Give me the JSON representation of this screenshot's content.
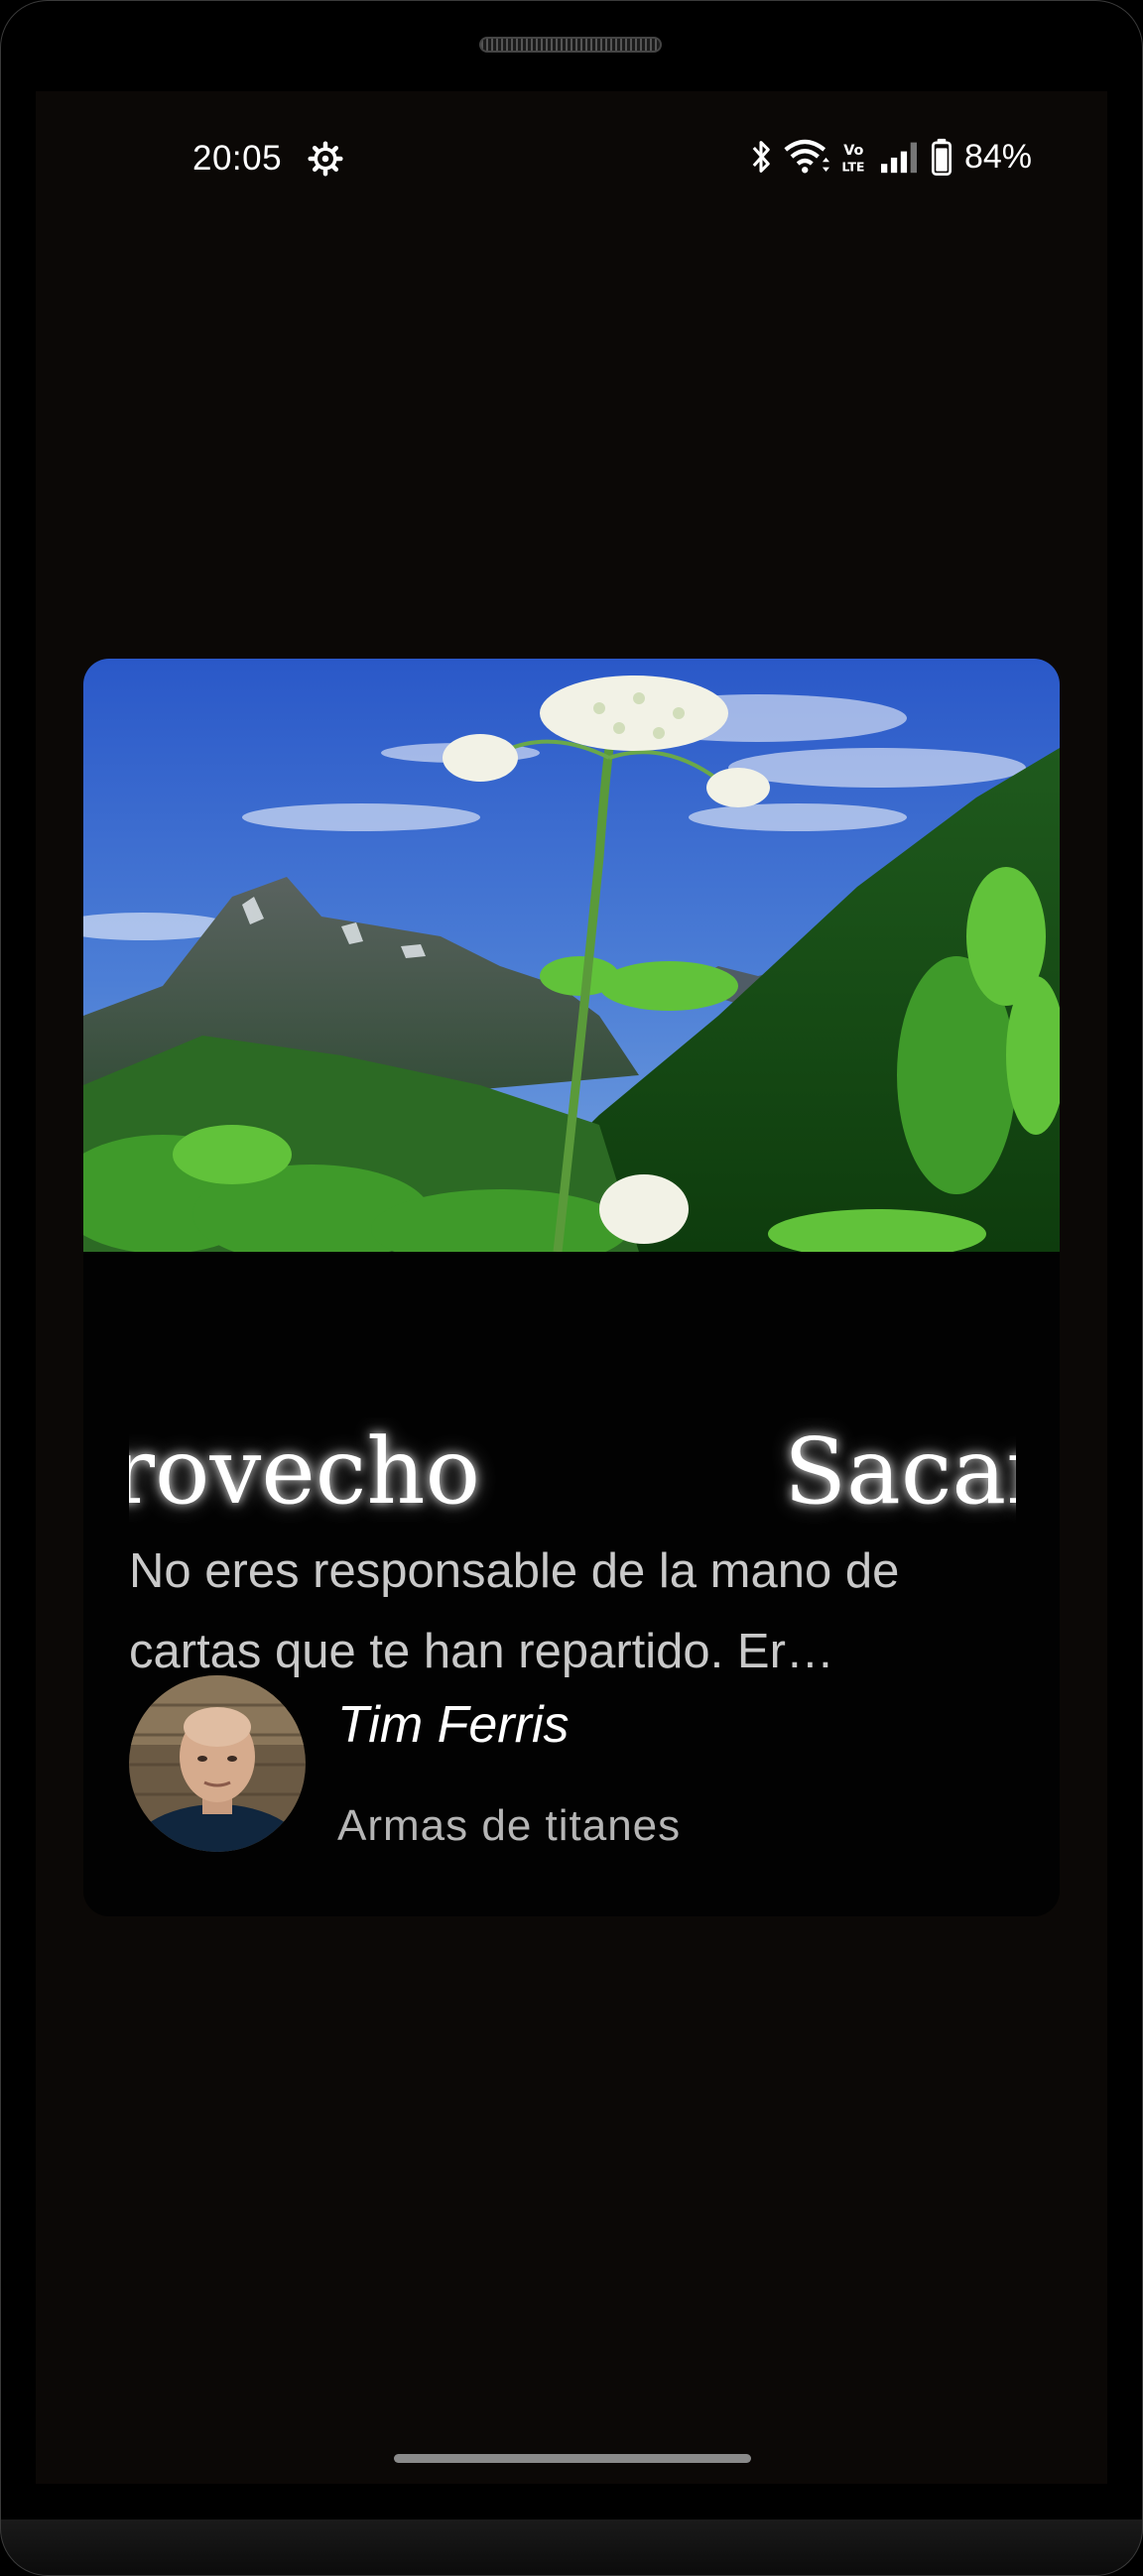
{
  "status_bar": {
    "time": "20:05",
    "battery_percent": "84%",
    "icons": [
      "settings-gear-icon",
      "bluetooth-icon",
      "wifi-icon",
      "volte-icon",
      "signal-icon",
      "battery-icon"
    ]
  },
  "card": {
    "image": "mountain-meadow-landscape",
    "marquee_part_1": "rovecho",
    "marquee_part_2": "Sacar",
    "quote": "No eres responsable de la mano de cartas que te han repartido. Er…",
    "author": "Tim Ferris",
    "book": "Armas de titanes"
  },
  "colors": {
    "screen_bg": "#0b0806",
    "card_bg": "#020202",
    "text_primary": "#ffffff",
    "text_secondary": "#c9c9c9"
  }
}
